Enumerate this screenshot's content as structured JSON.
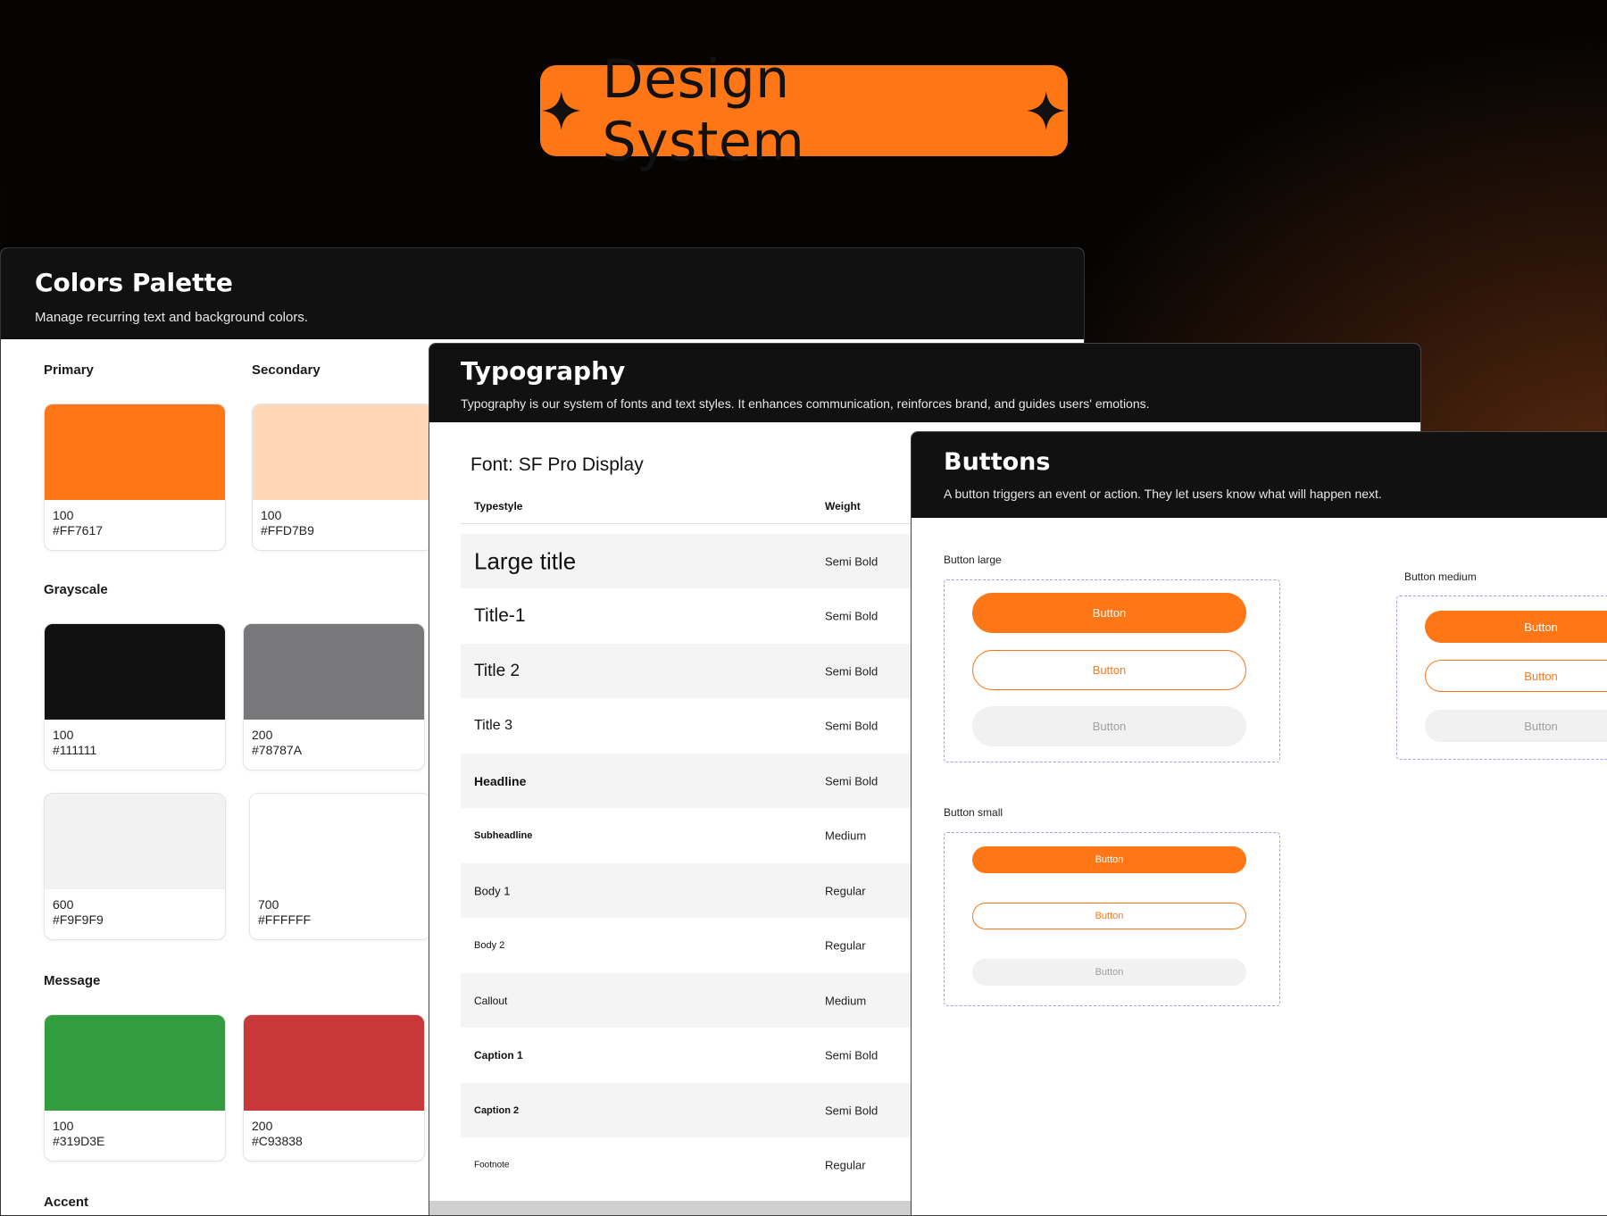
{
  "hero": {
    "title": "Design System"
  },
  "colors_panel": {
    "title": "Colors Palette",
    "subtitle": "Manage recurring text and background colors.",
    "groups": {
      "primary": {
        "label": "Primary",
        "swatches": [
          {
            "shade": "100",
            "hex": "#FF7617"
          }
        ]
      },
      "secondary": {
        "label": "Secondary",
        "swatches": [
          {
            "shade": "100",
            "hex": "#FFD7B9"
          }
        ]
      },
      "grayscale": {
        "label": "Grayscale",
        "swatches": [
          {
            "shade": "100",
            "hex": "#111111"
          },
          {
            "shade": "200",
            "hex": "#78787A"
          },
          {
            "shade": "600",
            "hex": "#F9F9F9"
          },
          {
            "shade": "700",
            "hex": "#FFFFFF"
          }
        ]
      },
      "message": {
        "label": "Message",
        "swatches": [
          {
            "shade": "100",
            "hex": "#319D3E"
          },
          {
            "shade": "200",
            "hex": "#C93838"
          }
        ]
      },
      "accent": {
        "label": "Accent"
      }
    }
  },
  "typography_panel": {
    "title": "Typography",
    "subtitle": "Typography is our system of fonts and text styles. It enhances communication, reinforces brand, and guides users' emotions.",
    "font_name": "Font: SF Pro Display",
    "columns": [
      "Typestyle",
      "Weight"
    ],
    "rows": [
      {
        "style": "Large title",
        "weight": "Semi Bold"
      },
      {
        "style": "Title-1",
        "weight": "Semi Bold"
      },
      {
        "style": "Title 2",
        "weight": "Semi Bold"
      },
      {
        "style": "Title 3",
        "weight": "Semi Bold"
      },
      {
        "style": "Headline",
        "weight": "Semi Bold"
      },
      {
        "style": "Subheadline",
        "weight": "Medium"
      },
      {
        "style": "Body 1",
        "weight": "Regular"
      },
      {
        "style": "Body 2",
        "weight": "Regular"
      },
      {
        "style": "Callout",
        "weight": "Medium"
      },
      {
        "style": "Caption 1",
        "weight": "Semi Bold"
      },
      {
        "style": "Caption 2",
        "weight": "Semi Bold"
      },
      {
        "style": "Footnote",
        "weight": "Regular"
      }
    ]
  },
  "buttons_panel": {
    "title": "Buttons",
    "subtitle": "A button triggers an event or action. They let users know what will happen next.",
    "large": {
      "label": "Button large",
      "primary": "Button",
      "outline": "Button",
      "disabled": "Button"
    },
    "medium": {
      "label": "Button medium",
      "primary": "Button",
      "outline": "Button",
      "disabled": "Button"
    },
    "small": {
      "label": "Button small",
      "primary": "Button",
      "outline": "Button",
      "disabled": "Button"
    }
  },
  "accent_color": "#FF7617",
  "icons": [
    "sparkle-icon"
  ]
}
